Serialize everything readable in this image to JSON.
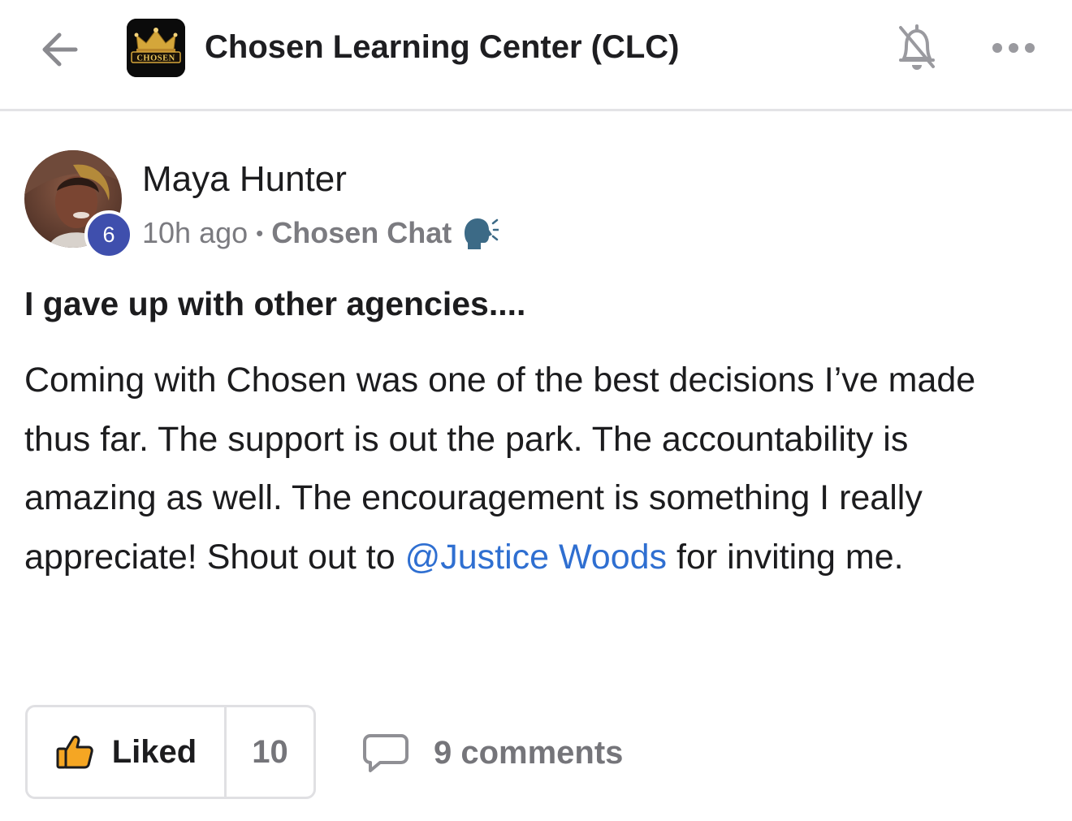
{
  "header": {
    "title": "Chosen Learning Center (CLC)",
    "logo_text": "CHOSEN",
    "back_icon": "arrow-left-icon",
    "bell_icon": "bell-off-icon",
    "more_icon": "more-horizontal-icon"
  },
  "post": {
    "author": {
      "name": "Maya Hunter",
      "level": "6"
    },
    "time": "10h ago",
    "separator": "•",
    "channel": "Chosen Chat",
    "channel_icon": "speaking-head-icon",
    "title": "I gave up with other agencies....",
    "body": {
      "before_mention": "Coming with Chosen was one of the best decisions I’ve made thus far. The support is out the park. The accountability is amazing as well. The encouragement is something I really appreciate! Shout out to ",
      "mention": "@Justice Woods",
      "after_mention": " for inviting me."
    },
    "actions": {
      "like_label": "Liked",
      "like_count": "10",
      "comments_label": "9 comments"
    }
  },
  "colors": {
    "mention": "#2f6fd1",
    "badge": "#3f4fad",
    "muted_text": "#7b7b80",
    "like_icon_fill": "#f5a623"
  }
}
